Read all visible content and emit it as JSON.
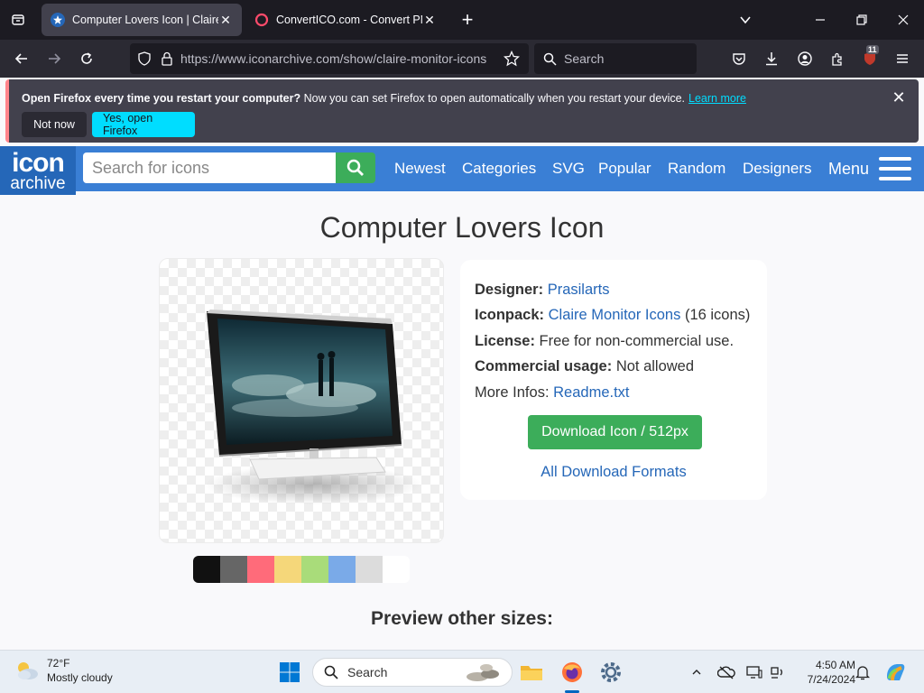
{
  "browser": {
    "tabs": [
      {
        "title": "Computer Lovers Icon | Claire",
        "active": true
      },
      {
        "title": "ConvertICO.com - Convert PNG",
        "active": false
      }
    ],
    "url": "https://www.iconarchive.com/show/claire-monitor-icons",
    "search_placeholder": "Search",
    "extension_badge": "11"
  },
  "notification": {
    "bold_text": "Open Firefox every time you restart your computer?",
    "text": " Now you can set Firefox to open automatically when you restart your device.",
    "learn_more": "Learn more",
    "btn_not_now": "Not now",
    "btn_yes": "Yes, open Firefox"
  },
  "site": {
    "logo_line1": "icon",
    "logo_line2": "archive",
    "search_placeholder": "Search for icons",
    "nav": [
      "Newest",
      "Categories",
      "SVG",
      "Popular",
      "Random",
      "Designers"
    ],
    "menu_label": "Menu"
  },
  "page": {
    "title": "Computer Lovers Icon",
    "designer_label": "Designer:",
    "designer_value": "Prasilarts",
    "iconpack_label": "Iconpack:",
    "iconpack_value": "Claire Monitor Icons",
    "iconpack_count": " (16 icons)",
    "license_label": "License:",
    "license_value": " Free for non-commercial use.",
    "commercial_label": "Commercial usage:",
    "commercial_value": " Not allowed",
    "more_infos_label": "More Infos: ",
    "more_infos_value": "Readme.txt",
    "download_button": "Download Icon / 512px",
    "all_formats": "All Download Formats",
    "preview_sizes": "Preview other sizes:"
  },
  "swatches": [
    "#111111",
    "#666666",
    "#ff6b7a",
    "#f5d77a",
    "#a9dc7a",
    "#7aaae8",
    "#dcdcdc",
    "#ffffff"
  ],
  "taskbar": {
    "temperature": "72°F",
    "condition": "Mostly cloudy",
    "search_label": "Search",
    "time": "4:50 AM",
    "date": "7/24/2024"
  },
  "colors": {
    "site_header": "#3a7fd5",
    "accent_green": "#3cad5a",
    "link_blue": "#2567b8"
  }
}
